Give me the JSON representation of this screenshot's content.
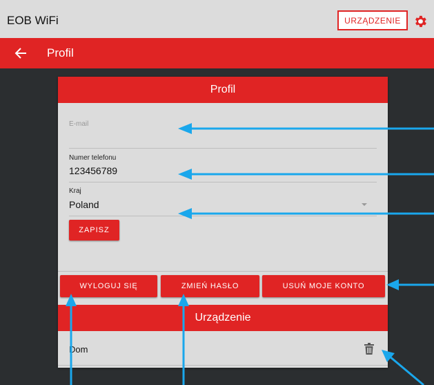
{
  "topbar": {
    "title": "EOB WiFi",
    "device_button": "URZĄDZENIE"
  },
  "subbar": {
    "title": "Profil"
  },
  "profile": {
    "header": "Profil",
    "email_label": "E-mail",
    "email_value": "",
    "phone_label": "Numer telefonu",
    "phone_value": "123456789",
    "country_label": "Kraj",
    "country_value": "Poland",
    "save_label": "ZAPISZ",
    "logout_label": "WYLOGUJ SIĘ",
    "change_password_label": "ZMIEŃ HASŁO",
    "delete_account_label": "USUŃ MOJE KONTO"
  },
  "devices": {
    "header": "Urządzenie",
    "items": [
      {
        "name": "Dom"
      }
    ]
  },
  "colors": {
    "accent": "#e02424",
    "annotation": "#1aa7ec",
    "background": "#2b2e30"
  }
}
